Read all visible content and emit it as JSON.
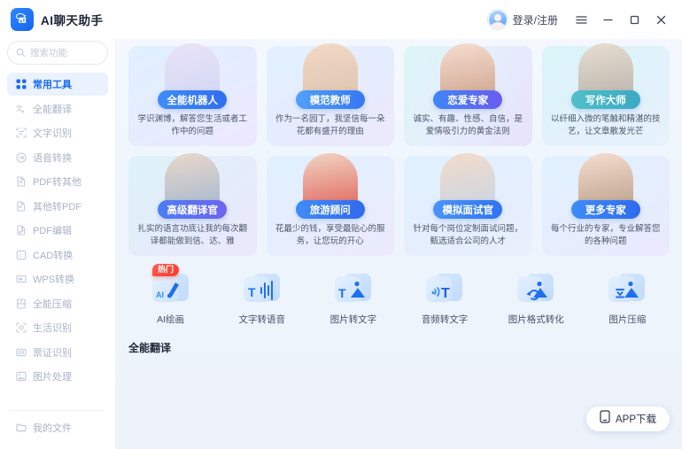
{
  "titlebar": {
    "logo_text": "ai",
    "app_title": "AI聊天助手",
    "account_label": "登录/注册",
    "menu_icon": "hamburger-icon",
    "minimize_icon": "minimize-icon",
    "maximize_icon": "maximize-icon",
    "close_icon": "close-icon"
  },
  "sidebar": {
    "search": {
      "placeholder": "搜索功能",
      "icon": "search-icon"
    },
    "items": [
      {
        "label": "常用工具",
        "icon": "grid-icon",
        "active": true
      },
      {
        "label": "全能翻译",
        "icon": "translate-icon",
        "active": false
      },
      {
        "label": "文字识别",
        "icon": "scan-text-icon",
        "active": false
      },
      {
        "label": "语音转换",
        "icon": "voice-icon",
        "active": false
      },
      {
        "label": "PDF转其他",
        "icon": "pdf-out-icon",
        "active": false
      },
      {
        "label": "其他转PDF",
        "icon": "pdf-in-icon",
        "active": false
      },
      {
        "label": "PDF编辑",
        "icon": "pdf-edit-icon",
        "active": false
      },
      {
        "label": "CAD转换",
        "icon": "cad-icon",
        "active": false
      },
      {
        "label": "WPS转换",
        "icon": "wps-icon",
        "active": false
      },
      {
        "label": "全能压缩",
        "icon": "compress-icon",
        "active": false
      },
      {
        "label": "生活识别",
        "icon": "life-scan-icon",
        "active": false
      },
      {
        "label": "票证识别",
        "icon": "ticket-icon",
        "active": false
      },
      {
        "label": "图片处理",
        "icon": "image-edit-icon",
        "active": false
      }
    ],
    "footer_item": {
      "label": "我的文件",
      "icon": "folder-icon"
    }
  },
  "main": {
    "agent_cards": [
      {
        "title": "全能机器人",
        "desc": "学识渊博，解答您生活或者工作中的问题",
        "card_bg": "linear-gradient(150deg,#dff0ff 0%,#e6ecff 55%,#eee8ff 100%)",
        "pill_bg": "linear-gradient(95deg,#3f8cf8,#2f6df0)",
        "portrait_a": "#e9e3f7",
        "portrait_b": "#cfd6f3"
      },
      {
        "title": "模范教师",
        "desc": "作为一名园丁，我坚信每一朵花都有盛开的理由",
        "card_bg": "linear-gradient(150deg,#e1f1ff 0%,#e6ebfd 60%,#ece9fb 100%)",
        "pill_bg": "linear-gradient(95deg,#52a0fb,#3577f2)",
        "portrait_a": "#f4d9c6",
        "portrait_b": "#d9c2ac"
      },
      {
        "title": "恋爱专家",
        "desc": "诚实、有趣、性感、自信，是爱情吸引力的黄金法则",
        "card_bg": "linear-gradient(120deg,#dcf6f7 0%,#e6edfc 50%,#e7e2fb 100%)",
        "pill_bg": "linear-gradient(95deg,#3f86f6,#6a5cf0)",
        "portrait_a": "#f6ddd0",
        "portrait_b": "#caa088"
      },
      {
        "title": "写作大师",
        "desc": "以纤细入微的笔触和精湛的技艺，让文章散发光芒",
        "card_bg": "linear-gradient(150deg,#d9f4f8 0%,#e2f1fb 60%,#e8f2fb 100%)",
        "pill_bg": "linear-gradient(95deg,#4fc0c9,#3ba9c3)",
        "portrait_a": "#e8ddd2",
        "portrait_b": "#b6b0a8"
      },
      {
        "title": "高级翻译官",
        "desc": "扎实的语言功底让我的每次翻译都能做到信、达、雅",
        "card_bg": "linear-gradient(140deg,#ddf2f9 0%,#e4ecfb 55%,#ebe7fb 100%)",
        "pill_bg": "linear-gradient(95deg,#4a7ef6,#6f63ef)",
        "portrait_a": "#ead7cb",
        "portrait_b": "#9fb7cf"
      },
      {
        "title": "旅游顾问",
        "desc": "花最少的钱，享受最贴心的服务，让您玩的开心",
        "card_bg": "linear-gradient(150deg,#dff0ff 0%,#e7edfd 60%,#ece9fd 100%)",
        "pill_bg": "linear-gradient(95deg,#3f8cf8,#3069ee)",
        "portrait_a": "#f0d5c4",
        "portrait_b": "#e05a52"
      },
      {
        "title": "模拟面试官",
        "desc": "针对每个岗位定制面试问题，甄选适合公司的人才",
        "card_bg": "linear-gradient(150deg,#dff1ff 0%,#e5eefd 60%,#e8f0fd 100%)",
        "pill_bg": "linear-gradient(95deg,#4b94f9,#2f74f1)",
        "portrait_a": "#f2dccb",
        "portrait_b": "#c6d4e6"
      },
      {
        "title": "更多专家",
        "desc": "每个行业的专家，专业解答您的各种问题",
        "card_bg": "linear-gradient(150deg,#e0f1ff 0%,#e6edfd 60%,#eae9fd 100%)",
        "pill_bg": "linear-gradient(95deg,#3f8cf8,#2e6bee)",
        "portrait_a": "#f5ded0",
        "portrait_b": "#b69a84"
      }
    ],
    "tools": [
      {
        "label": "AI绘画",
        "icon": "ai-paint-icon",
        "badge": "热门"
      },
      {
        "label": "文字转语音",
        "icon": "text-to-speech-icon",
        "badge": ""
      },
      {
        "label": "图片转文字",
        "icon": "image-to-text-icon",
        "badge": ""
      },
      {
        "label": "音频转文字",
        "icon": "audio-to-text-icon",
        "badge": ""
      },
      {
        "label": "图片格式转化",
        "icon": "image-format-icon",
        "badge": ""
      },
      {
        "label": "图片压缩",
        "icon": "image-compress-icon",
        "badge": ""
      }
    ],
    "section_title": "全能翻译",
    "app_download": {
      "label": "APP下载",
      "icon": "phone-icon"
    }
  },
  "colors": {
    "accent": "#1a6bf0",
    "sidebar_active_bg": "#eaf2ff",
    "badge_red": "#f53b2f",
    "main_bg": "#eef4fc"
  }
}
